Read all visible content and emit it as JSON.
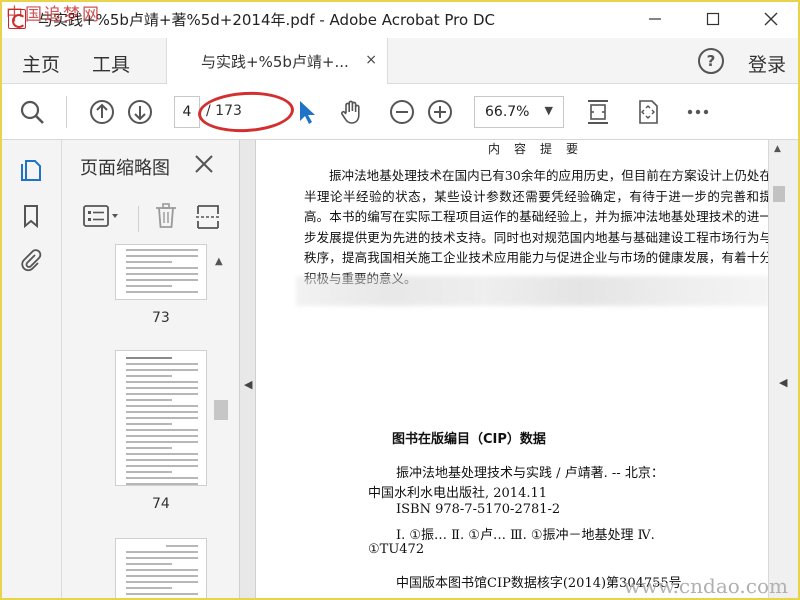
{
  "window": {
    "title": "与实践+%5b卢靖+著%5d+2014年.pdf - Adobe Acrobat Pro DC"
  },
  "watermarks": {
    "top": "中国追梦网",
    "bottom": "www.cndao.com"
  },
  "menu": {
    "home": "主页",
    "tools": "工具",
    "login": "登录"
  },
  "tab": {
    "label": "与实践+%5b卢靖+...",
    "close": "×"
  },
  "toolbar": {
    "current_page": "4",
    "total_pages": "/ 173",
    "zoom": "66.7%"
  },
  "thumbnails": {
    "title": "页面缩略图",
    "pages": [
      {
        "number": "73"
      },
      {
        "number": "74"
      }
    ]
  },
  "document": {
    "heading": "内容提要",
    "paragraph": "振冲法地基处理技术在国内已有30余年的应用历史，但目前在方案设计上仍处在半理论半经验的状态，某些设计参数还需要凭经验确定，有待于进一步的完善和提高。本书的编写在实际工程项目运作的基础经验上，并为振冲法地基处理技术的进一步发展提供更为先进的技术支持。同时也对规范国内地基与基础建设工程市场行为与秩序，提高我国相关施工企业技术应用能力与促进企业与市场的健康发展，有着十分积极与重要的意义。",
    "cip_title": "图书在版编目（CIP）数据",
    "cip_lines": [
      "振冲法地基处理技术与实践 / 卢靖著. -- 北京：",
      "中国水利水电出版社, 2014.11",
      "ISBN 978-7-5170-2781-2",
      "Ⅰ. ①振… Ⅱ. ①卢… Ⅲ. ①振冲－地基处理 Ⅳ.",
      "①TU472",
      "中国版本图书馆CIP数据核字(2014)第304755号"
    ]
  }
}
